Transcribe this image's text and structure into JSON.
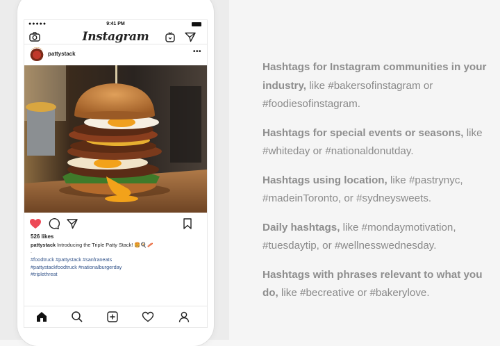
{
  "phone": {
    "status": {
      "signal": "●●●●●",
      "time": "9:41 PM"
    },
    "nav": {
      "app_title": "Instagram"
    },
    "post": {
      "username": "pattystack",
      "more": "•••",
      "likes": "526 likes",
      "caption_user": "pattystack",
      "caption_text": "Introducing the Triple Patty Stack!",
      "caption_emoji": "🍔🍳🥓",
      "dot": ".",
      "hashtags_line1": "#foodtruck #pattystack #sanfraneats",
      "hashtags_line2": "#pattystackfoodtruck #nationalburgerday",
      "hashtags_line3": "#triplethreat"
    },
    "icons": {
      "nav": [
        "camera-icon",
        "igtv-icon",
        "direct-message-icon"
      ],
      "actions": [
        "heart-icon",
        "comment-icon",
        "share-icon",
        "bookmark-icon"
      ],
      "tabs": [
        "home-icon",
        "search-icon",
        "add-post-icon",
        "activity-heart-icon",
        "profile-icon"
      ]
    },
    "colors": {
      "like": "#ed4956",
      "hashtag": "#34558b"
    }
  },
  "info": {
    "items": [
      {
        "lead": "Hashtags for Instagram communities in your industry,",
        "rest": " like #bakersofinstagram or #foodiesofinstagram."
      },
      {
        "lead": "Hashtags for special events or seasons,",
        "rest": " like #whiteday or #nationaldonutday."
      },
      {
        "lead": "Hashtags using location,",
        "rest": " like #pastrynyc, #madeinToronto, or #sydneysweets."
      },
      {
        "lead": "Daily hashtags,",
        "rest": " like #mondaymotivation, #tuesdaytip, or #wellnesswednesday."
      },
      {
        "lead": "Hashtags with phrases relevant to what you do,",
        "rest": " like #becreative or #bakerylove."
      }
    ]
  }
}
